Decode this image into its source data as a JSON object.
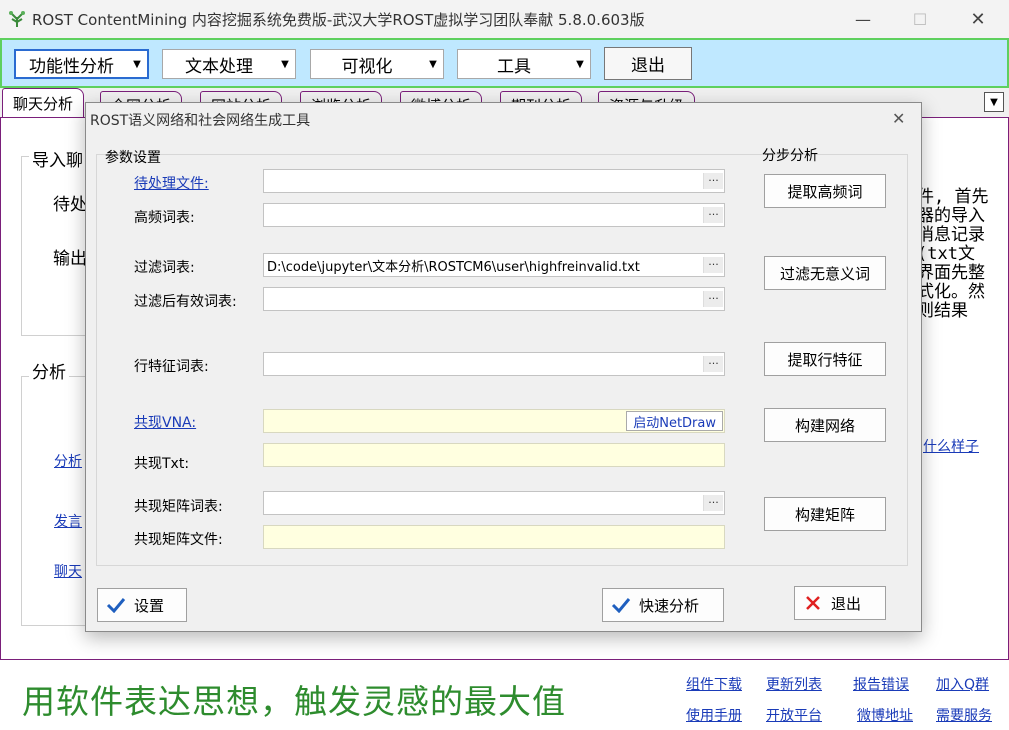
{
  "window": {
    "title": "ROST ContentMining 内容挖掘系统免费版-武汉大学ROST虚拟学习团队奉献  5.8.0.603版",
    "minimize": "—",
    "maximize": "☐",
    "close": "✕"
  },
  "toolbar": {
    "menus": [
      "功能性分析",
      "文本处理",
      "可视化",
      "工具"
    ],
    "exit_label": "退出"
  },
  "tabs": [
    "聊天分析",
    "全网分析",
    "网站分析",
    "浏览分析",
    "微博分析",
    "期刊分析",
    "资源与升级"
  ],
  "background": {
    "import_group": "导入聊",
    "pending": "待处",
    "output": "输出",
    "analysis_group": "分析",
    "link_analyze": "分析",
    "link_speak": "发言",
    "link_chat": "聊天",
    "right_desc": "件, 首先\n器的导入\n消息记录\n(txt文\n界面先整\n式化。然\n则结果",
    "what_link": "什么样子"
  },
  "footer": {
    "slogan": "用软件表达思想，触发灵感的最大值",
    "links_row1": [
      "组件下载",
      "更新列表",
      "报告错误",
      "加入Q群"
    ],
    "links_row2": [
      "使用手册",
      "开放平台",
      "微博地址",
      "需要服务"
    ]
  },
  "dialog": {
    "title": "ROST语义网络和社会网络生成工具",
    "close": "✕",
    "param_section": "参数设置",
    "step_section": "分步分析",
    "fields": {
      "pending_file": {
        "label": "待处理文件:",
        "value": ""
      },
      "high_freq": {
        "label": "高频词表:",
        "value": ""
      },
      "filter": {
        "label": "过滤词表:",
        "value": "D:\\code\\jupyter\\文本分析\\ROSTCM6\\user\\highfreinvalid.txt"
      },
      "filtered_valid": {
        "label": "过滤后有效词表:",
        "value": ""
      },
      "row_feature": {
        "label": "行特征词表:",
        "value": ""
      },
      "co_vna": {
        "label": "共现VNA:",
        "value": ""
      },
      "co_txt": {
        "label": "共现Txt:",
        "value": ""
      },
      "matrix_words": {
        "label": "共现矩阵词表:",
        "value": ""
      },
      "matrix_file": {
        "label": "共现矩阵文件:",
        "value": ""
      }
    },
    "browse_label": "...",
    "netdraw_label": "启动NetDraw",
    "step_buttons": [
      "提取高频词",
      "过滤无意义词",
      "提取行特征",
      "构建网络",
      "构建矩阵"
    ],
    "settings_label": "设置",
    "quick_label": "快速分析",
    "exit_label": "退出",
    "colors": {
      "check": "#1f5fbf",
      "cross": "#e02020",
      "link": "#1a3bb8",
      "highlight_field": "#ffffe0"
    }
  }
}
